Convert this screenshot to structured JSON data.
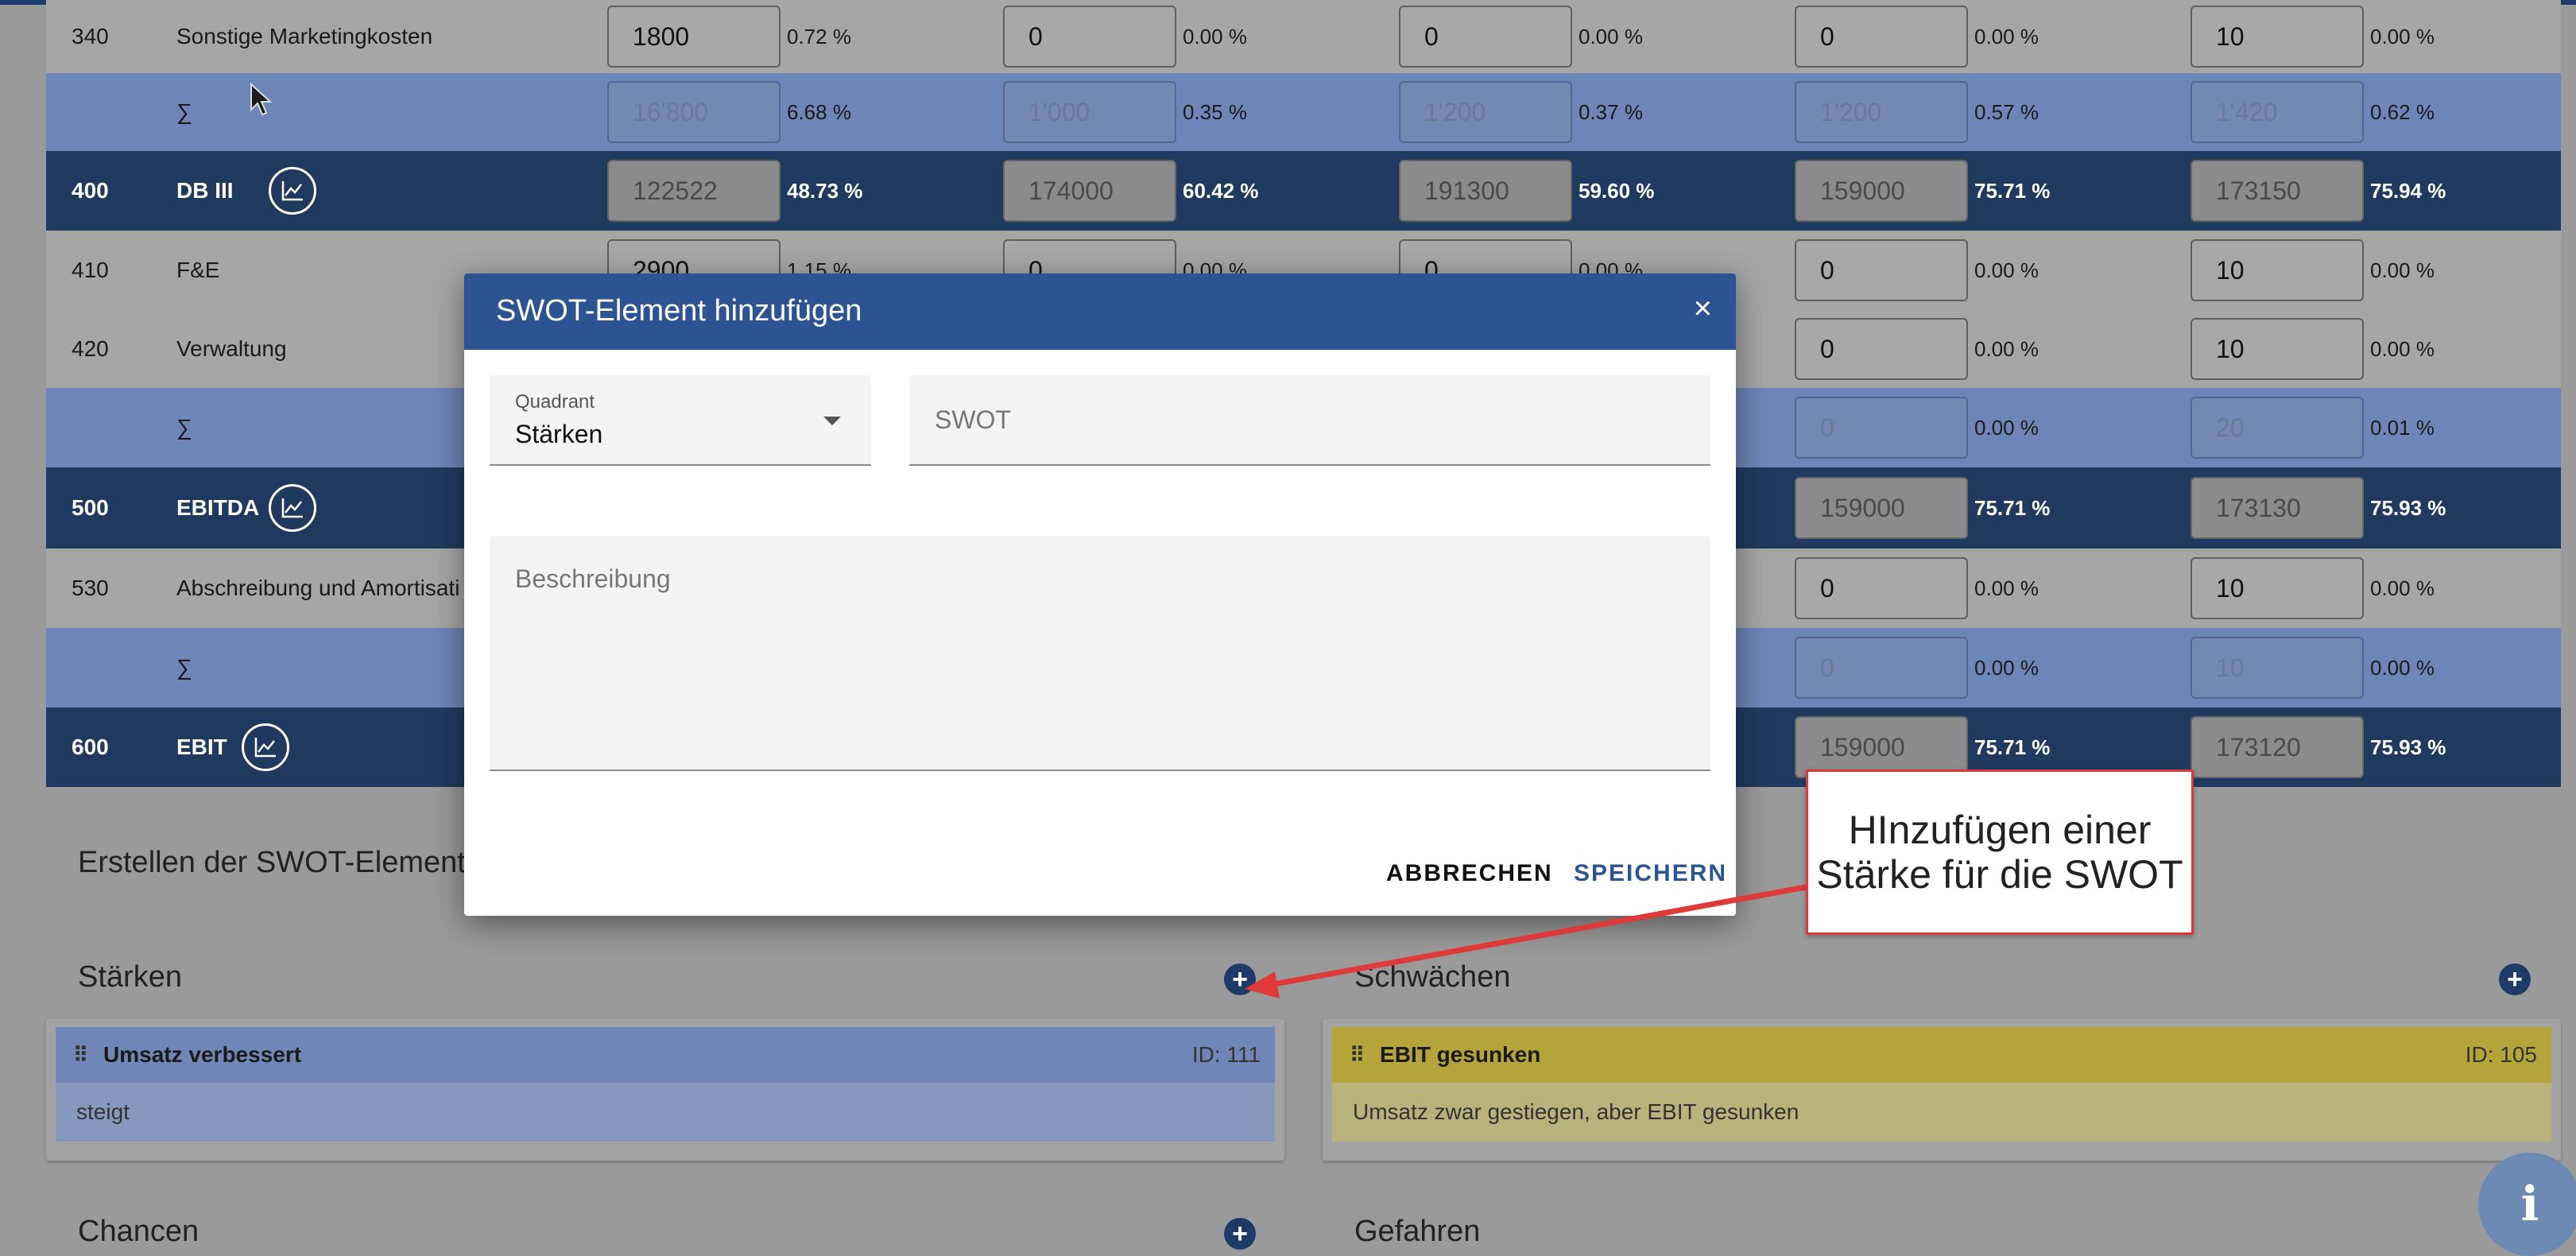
{
  "table": {
    "rows": [
      {
        "type": "normal",
        "code": "340",
        "name": "Sonstige Marketingkosten",
        "cols": [
          {
            "v": "1800",
            "p": "0.72 %"
          },
          {
            "v": "0",
            "p": "0.00 %"
          },
          {
            "v": "0",
            "p": "0.00 %"
          },
          {
            "v": "0",
            "p": "0.00 %"
          },
          {
            "v": "10",
            "p": "0.00 %"
          }
        ]
      },
      {
        "type": "sum",
        "code": "",
        "name": "∑",
        "cols": [
          {
            "v": "16'800",
            "p": "6.68 %"
          },
          {
            "v": "1'000",
            "p": "0.35 %"
          },
          {
            "v": "1'200",
            "p": "0.37 %"
          },
          {
            "v": "1'200",
            "p": "0.57 %"
          },
          {
            "v": "1'420",
            "p": "0.62 %"
          }
        ]
      },
      {
        "type": "dark",
        "code": "400",
        "name": "DB III",
        "chart": true,
        "cols": [
          {
            "v": "122522",
            "p": "48.73 %"
          },
          {
            "v": "174000",
            "p": "60.42 %"
          },
          {
            "v": "191300",
            "p": "59.60 %"
          },
          {
            "v": "159000",
            "p": "75.71 %"
          },
          {
            "v": "173150",
            "p": "75.94 %"
          }
        ]
      },
      {
        "type": "normal",
        "code": "410",
        "name": "F&E",
        "cols": [
          {
            "v": "2900",
            "p": "1.15 %"
          },
          {
            "v": "0",
            "p": "0.00 %"
          },
          {
            "v": "0",
            "p": "0.00 %"
          },
          {
            "v": "0",
            "p": "0.00 %"
          },
          {
            "v": "10",
            "p": "0.00 %"
          }
        ]
      },
      {
        "type": "normal",
        "code": "420",
        "name": "Verwaltung",
        "cols": [
          {
            "v": "",
            "p": ""
          },
          {
            "v": "",
            "p": ""
          },
          {
            "v": "",
            "p": ""
          },
          {
            "v": "0",
            "p": "0.00 %"
          },
          {
            "v": "10",
            "p": "0.00 %"
          }
        ]
      },
      {
        "type": "sum",
        "code": "",
        "name": "∑",
        "cols": [
          {
            "v": "",
            "p": ""
          },
          {
            "v": "",
            "p": ""
          },
          {
            "v": "",
            "p": ""
          },
          {
            "v": "0",
            "p": "0.00 %"
          },
          {
            "v": "20",
            "p": "0.01 %"
          }
        ]
      },
      {
        "type": "dark",
        "code": "500",
        "name": "EBITDA",
        "chart": true,
        "cols": [
          {
            "v": "",
            "p": ""
          },
          {
            "v": "",
            "p": ""
          },
          {
            "v": "",
            "p": ""
          },
          {
            "v": "159000",
            "p": "75.71 %"
          },
          {
            "v": "173130",
            "p": "75.93 %"
          }
        ]
      },
      {
        "type": "normal",
        "code": "530",
        "name": "Abschreibung und Amortisati",
        "cols": [
          {
            "v": "",
            "p": ""
          },
          {
            "v": "",
            "p": ""
          },
          {
            "v": "",
            "p": ""
          },
          {
            "v": "0",
            "p": "0.00 %"
          },
          {
            "v": "10",
            "p": "0.00 %"
          }
        ]
      },
      {
        "type": "sum",
        "code": "",
        "name": "∑",
        "cols": [
          {
            "v": "",
            "p": ""
          },
          {
            "v": "",
            "p": ""
          },
          {
            "v": "",
            "p": ""
          },
          {
            "v": "0",
            "p": "0.00 %"
          },
          {
            "v": "10",
            "p": "0.00 %"
          }
        ]
      },
      {
        "type": "dark",
        "code": "600",
        "name": "EBIT",
        "chart": true,
        "cols": [
          {
            "v": "",
            "p": ""
          },
          {
            "v": "",
            "p": ""
          },
          {
            "v": "",
            "p": ""
          },
          {
            "v": "159000",
            "p": "75.71 %"
          },
          {
            "v": "173120",
            "p": "75.93 %"
          }
        ]
      }
    ]
  },
  "swot": {
    "heading": "Erstellen der SWOT-Element",
    "staerken": {
      "title": "Stärken",
      "card": {
        "title": "Umsatz verbessert",
        "id": "ID: 111",
        "body": "steigt",
        "color": "#6f86b6"
      }
    },
    "schwaechen": {
      "title": "Schwächen",
      "card": {
        "title": "EBIT gesunken",
        "id": "ID: 105",
        "body": "Umsatz zwar gestiegen, aber EBIT gesunken",
        "color": "#b5a43a"
      }
    },
    "chancen": {
      "title": "Chancen"
    },
    "gefahren": {
      "title": "Gefahren"
    }
  },
  "modal": {
    "title": "SWOT-Element hinzufügen",
    "close": "×",
    "quadrant_label": "Quadrant",
    "quadrant_value": "Stärken",
    "swot_placeholder": "SWOT",
    "beschreibung_placeholder": "Beschreibung",
    "cancel": "ABBRECHEN",
    "save": "SPEICHERN"
  },
  "callout": {
    "line1": "HInzufügen einer",
    "line2": "Stärke für die SWOT"
  },
  "info_icon": "i",
  "colors": {
    "accent": "#2d5492",
    "dark_row": "#203a5f",
    "sum_row": "#6e86b7",
    "annotation": "#e0393a"
  }
}
